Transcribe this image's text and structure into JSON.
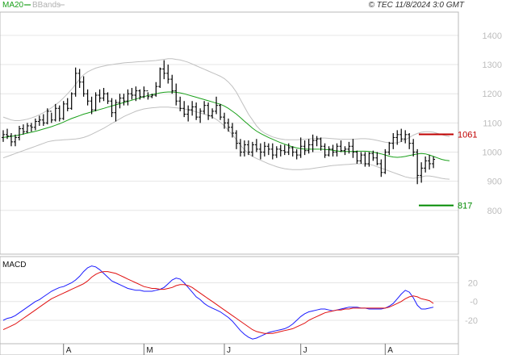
{
  "header": {
    "ma_label": "MA20",
    "bbands_label": "BBands",
    "copyright": "© TEC 11/8/2024 3:0 GMT"
  },
  "colors": {
    "ma": "#1aa01a",
    "bbands": "#c0c0c0",
    "grid": "#e6e6e6",
    "candle": "#000000",
    "macd": "#1a1aff",
    "signal": "#e01010",
    "resistance": "#c00000",
    "support": "#008a00"
  },
  "chart_data": [
    {
      "type": "line",
      "name": "price",
      "yticks": [
        800,
        900,
        1000,
        1100,
        1200,
        1300,
        1400
      ],
      "ylim": [
        650,
        1480
      ],
      "xlim": [
        0,
        112
      ],
      "month_ticks": [
        {
          "label": "A",
          "x": 15
        },
        {
          "label": "M",
          "x": 35
        },
        {
          "label": "J",
          "x": 55
        },
        {
          "label": "J",
          "x": 74
        },
        {
          "label": "A",
          "x": 95
        }
      ],
      "ohlc": [
        [
          1050,
          1075,
          1035,
          1060
        ],
        [
          1060,
          1080,
          1045,
          1055
        ],
        [
          1055,
          1065,
          1020,
          1035
        ],
        [
          1035,
          1060,
          1020,
          1050
        ],
        [
          1050,
          1090,
          1040,
          1080
        ],
        [
          1080,
          1095,
          1060,
          1070
        ],
        [
          1070,
          1100,
          1065,
          1090
        ],
        [
          1090,
          1100,
          1070,
          1085
        ],
        [
          1085,
          1115,
          1075,
          1105
        ],
        [
          1105,
          1125,
          1090,
          1110
        ],
        [
          1110,
          1130,
          1090,
          1100
        ],
        [
          1100,
          1150,
          1095,
          1140
        ],
        [
          1140,
          1135,
          1100,
          1110
        ],
        [
          1110,
          1165,
          1105,
          1150
        ],
        [
          1150,
          1160,
          1105,
          1115
        ],
        [
          1115,
          1175,
          1110,
          1165
        ],
        [
          1165,
          1185,
          1140,
          1150
        ],
        [
          1150,
          1205,
          1145,
          1200
        ],
        [
          1200,
          1290,
          1190,
          1270
        ],
        [
          1270,
          1285,
          1220,
          1240
        ],
        [
          1240,
          1260,
          1190,
          1200
        ],
        [
          1200,
          1215,
          1160,
          1175
        ],
        [
          1175,
          1190,
          1130,
          1145
        ],
        [
          1145,
          1205,
          1140,
          1195
        ],
        [
          1195,
          1215,
          1170,
          1185
        ],
        [
          1185,
          1220,
          1175,
          1200
        ],
        [
          1200,
          1205,
          1165,
          1175
        ],
        [
          1175,
          1185,
          1120,
          1135
        ],
        [
          1135,
          1180,
          1105,
          1170
        ],
        [
          1170,
          1200,
          1150,
          1185
        ],
        [
          1185,
          1200,
          1160,
          1175
        ],
        [
          1175,
          1215,
          1160,
          1200
        ],
        [
          1200,
          1220,
          1180,
          1195
        ],
        [
          1195,
          1225,
          1175,
          1210
        ],
        [
          1210,
          1215,
          1180,
          1190
        ],
        [
          1190,
          1225,
          1185,
          1210
        ],
        [
          1210,
          1205,
          1180,
          1190
        ],
        [
          1190,
          1200,
          1185,
          1195
        ],
        [
          1195,
          1240,
          1190,
          1225
        ],
        [
          1225,
          1290,
          1220,
          1285
        ],
        [
          1285,
          1315,
          1250,
          1270
        ],
        [
          1270,
          1300,
          1235,
          1250
        ],
        [
          1250,
          1265,
          1200,
          1210
        ],
        [
          1210,
          1235,
          1160,
          1175
        ],
        [
          1175,
          1190,
          1140,
          1150
        ],
        [
          1150,
          1175,
          1120,
          1130
        ],
        [
          1130,
          1160,
          1105,
          1145
        ],
        [
          1145,
          1175,
          1125,
          1155
        ],
        [
          1155,
          1170,
          1110,
          1120
        ],
        [
          1120,
          1150,
          1100,
          1140
        ],
        [
          1140,
          1175,
          1130,
          1160
        ],
        [
          1160,
          1170,
          1110,
          1125
        ],
        [
          1125,
          1150,
          1115,
          1140
        ],
        [
          1140,
          1190,
          1130,
          1160
        ],
        [
          1160,
          1165,
          1110,
          1120
        ],
        [
          1120,
          1135,
          1080,
          1100
        ],
        [
          1100,
          1115,
          1070,
          1085
        ],
        [
          1085,
          1100,
          1050,
          1065
        ],
        [
          1065,
          1075,
          1010,
          1030
        ],
        [
          1030,
          1045,
          985,
          1000
        ],
        [
          1000,
          1040,
          985,
          1025
        ],
        [
          1025,
          1040,
          990,
          1000
        ],
        [
          1000,
          1035,
          985,
          1025
        ],
        [
          1025,
          1045,
          1000,
          1010
        ],
        [
          1010,
          1030,
          975,
          1000
        ],
        [
          1000,
          1035,
          985,
          1020
        ],
        [
          1020,
          1030,
          990,
          1010
        ],
        [
          1010,
          1030,
          975,
          990
        ],
        [
          990,
          1020,
          980,
          1010
        ],
        [
          1010,
          1025,
          985,
          1005
        ],
        [
          1005,
          1025,
          990,
          1000
        ],
        [
          1000,
          1030,
          990,
          1015
        ],
        [
          1015,
          1020,
          985,
          1000
        ],
        [
          1000,
          1010,
          975,
          990
        ],
        [
          990,
          1050,
          980,
          1020
        ],
        [
          1020,
          1040,
          990,
          1005
        ],
        [
          1005,
          1045,
          995,
          1025
        ],
        [
          1025,
          1060,
          1000,
          1040
        ],
        [
          1040,
          1055,
          1020,
          1045
        ],
        [
          1045,
          1050,
          1005,
          1020
        ],
        [
          1020,
          1030,
          980,
          990
        ],
        [
          990,
          1020,
          985,
          1010
        ],
        [
          1010,
          1025,
          985,
          1000
        ],
        [
          1000,
          1030,
          985,
          1020
        ],
        [
          1020,
          1040,
          1000,
          1005
        ],
        [
          1005,
          1020,
          990,
          1010
        ],
        [
          1010,
          1035,
          995,
          1020
        ],
        [
          1020,
          1045,
          980,
          1000
        ],
        [
          1000,
          1005,
          960,
          970
        ],
        [
          970,
          1000,
          960,
          990
        ],
        [
          990,
          1000,
          950,
          960
        ],
        [
          960,
          1000,
          950,
          995
        ],
        [
          995,
          1005,
          970,
          980
        ],
        [
          980,
          1000,
          955,
          960
        ],
        [
          960,
          975,
          915,
          930
        ],
        [
          930,
          1010,
          925,
          1000
        ],
        [
          1000,
          1035,
          990,
          1030
        ],
        [
          1030,
          1065,
          1010,
          1050
        ],
        [
          1050,
          1075,
          1025,
          1060
        ],
        [
          1060,
          1080,
          1035,
          1045
        ],
        [
          1045,
          1075,
          1030,
          1060
        ],
        [
          1060,
          1065,
          1010,
          1030
        ],
        [
          1030,
          1045,
          985,
          1000
        ],
        [
          1000,
          1010,
          890,
          920
        ],
        [
          920,
          965,
          895,
          945
        ],
        [
          945,
          985,
          930,
          970
        ],
        [
          970,
          990,
          940,
          960
        ],
        [
          960,
          985,
          945,
          975
        ]
      ],
      "ma20": [
        1050,
        1052,
        1054,
        1056,
        1059,
        1062,
        1065,
        1068,
        1071,
        1075,
        1079,
        1083,
        1087,
        1092,
        1097,
        1103,
        1109,
        1115,
        1120,
        1125,
        1130,
        1134,
        1138,
        1142,
        1146,
        1150,
        1154,
        1158,
        1162,
        1166,
        1170,
        1174,
        1178,
        1182,
        1186,
        1190,
        1194,
        1197,
        1200,
        1203,
        1205,
        1206,
        1206,
        1205,
        1203,
        1200,
        1196,
        1192,
        1188,
        1184,
        1180,
        1176,
        1172,
        1168,
        1164,
        1158,
        1150,
        1140,
        1130,
        1118,
        1106,
        1094,
        1082,
        1072,
        1064,
        1057,
        1050,
        1044,
        1038,
        1032,
        1027,
        1022,
        1018,
        1014,
        1012,
        1010,
        1010,
        1010,
        1010,
        1010,
        1009,
        1008,
        1006,
        1004,
        1002,
        1002,
        1002,
        1002,
        1003,
        1003,
        1003,
        1002,
        1000,
        997,
        994,
        990,
        986,
        983,
        982,
        983,
        985,
        988,
        991,
        994,
        995,
        994,
        990,
        985,
        980,
        975,
        972,
        970
      ],
      "bb_upper": [
        1120,
        1115,
        1110,
        1108,
        1108,
        1110,
        1113,
        1117,
        1122,
        1128,
        1135,
        1143,
        1152,
        1162,
        1173,
        1186,
        1200,
        1215,
        1232,
        1250,
        1265,
        1275,
        1282,
        1288,
        1292,
        1295,
        1298,
        1300,
        1302,
        1304,
        1306,
        1307,
        1308,
        1309,
        1310,
        1311,
        1312,
        1313,
        1314,
        1316,
        1318,
        1320,
        1320,
        1318,
        1316,
        1312,
        1308,
        1302,
        1296,
        1290,
        1284,
        1278,
        1272,
        1266,
        1260,
        1252,
        1240,
        1225,
        1205,
        1180,
        1155,
        1130,
        1110,
        1090,
        1075,
        1065,
        1058,
        1052,
        1048,
        1045,
        1043,
        1042,
        1042,
        1042,
        1043,
        1044,
        1045,
        1046,
        1047,
        1048,
        1048,
        1047,
        1046,
        1045,
        1044,
        1044,
        1044,
        1044,
        1045,
        1046,
        1046,
        1045,
        1043,
        1040,
        1037,
        1034,
        1032,
        1031,
        1032,
        1036,
        1042,
        1050,
        1058,
        1064,
        1068,
        1070,
        1070,
        1068,
        1064,
        1060,
        1056,
        1053
      ],
      "bb_lower": [
        980,
        985,
        990,
        995,
        1000,
        1005,
        1010,
        1015,
        1020,
        1025,
        1030,
        1035,
        1038,
        1040,
        1041,
        1042,
        1043,
        1044,
        1045,
        1047,
        1050,
        1055,
        1061,
        1068,
        1075,
        1082,
        1090,
        1098,
        1106,
        1114,
        1122,
        1128,
        1134,
        1140,
        1144,
        1148,
        1150,
        1152,
        1153,
        1154,
        1154,
        1154,
        1153,
        1152,
        1150,
        1148,
        1145,
        1142,
        1138,
        1134,
        1130,
        1126,
        1120,
        1112,
        1102,
        1090,
        1075,
        1060,
        1042,
        1024,
        1008,
        995,
        985,
        978,
        972,
        966,
        960,
        955,
        950,
        946,
        943,
        941,
        940,
        940,
        940,
        941,
        942,
        944,
        946,
        948,
        950,
        952,
        954,
        955,
        956,
        957,
        958,
        959,
        960,
        960,
        960,
        958,
        955,
        950,
        945,
        940,
        935,
        930,
        925,
        920,
        915,
        912,
        910,
        912,
        915,
        918,
        918,
        916,
        913,
        910,
        908,
        907
      ],
      "levels": [
        {
          "value": 1061,
          "label": "1061",
          "role": "resistance"
        },
        {
          "value": 817,
          "label": "817",
          "role": "support"
        }
      ]
    },
    {
      "type": "line",
      "name": "MACD",
      "title": "MACD",
      "yticks": [
        20,
        0,
        -20
      ],
      "ytick_labels": [
        "20",
        "-0",
        "-20"
      ],
      "ylim": [
        -45,
        48
      ],
      "series": [
        {
          "key": "macd",
          "values": [
            -20,
            -18,
            -17,
            -15,
            -12,
            -9,
            -6,
            -3,
            0,
            2,
            5,
            8,
            11,
            13,
            15,
            16,
            18,
            20,
            23,
            27,
            32,
            36,
            38,
            37,
            34,
            30,
            26,
            22,
            20,
            18,
            16,
            14,
            13,
            12,
            12,
            11,
            11,
            11,
            12,
            13,
            15,
            19,
            23,
            25,
            24,
            20,
            15,
            10,
            5,
            2,
            -2,
            -5,
            -7,
            -9,
            -11,
            -14,
            -17,
            -21,
            -26,
            -31,
            -35,
            -38,
            -40,
            -39,
            -37,
            -35,
            -33,
            -32,
            -31,
            -30,
            -29,
            -27,
            -24,
            -20,
            -16,
            -13,
            -11,
            -10,
            -9,
            -8,
            -8,
            -9,
            -10,
            -9,
            -8,
            -7,
            -6,
            -6,
            -6,
            -7,
            -7,
            -8,
            -8,
            -8,
            -8,
            -7,
            -5,
            -2,
            3,
            8,
            12,
            10,
            4,
            -4,
            -8,
            -8,
            -7,
            -6
          ]
        },
        {
          "key": "signal",
          "values": [
            -30,
            -28,
            -26,
            -24,
            -21,
            -18,
            -15,
            -12,
            -9,
            -6,
            -3,
            0,
            3,
            5,
            7,
            9,
            11,
            13,
            15,
            17,
            19,
            22,
            26,
            29,
            31,
            32,
            32,
            31,
            30,
            28,
            26,
            24,
            22,
            20,
            18,
            16,
            15,
            14,
            14,
            13,
            13,
            14,
            15,
            17,
            18,
            18,
            17,
            15,
            12,
            9,
            6,
            3,
            0,
            -3,
            -6,
            -9,
            -12,
            -15,
            -18,
            -21,
            -24,
            -27,
            -30,
            -32,
            -33,
            -34,
            -34,
            -34,
            -33,
            -32,
            -31,
            -30,
            -29,
            -27,
            -25,
            -23,
            -20,
            -18,
            -16,
            -14,
            -12,
            -11,
            -10,
            -9,
            -9,
            -8,
            -8,
            -7,
            -7,
            -7,
            -7,
            -7,
            -7,
            -7,
            -7,
            -7,
            -6,
            -4,
            -2,
            0,
            3,
            5,
            6,
            5,
            3,
            2,
            1,
            -2
          ]
        }
      ]
    }
  ]
}
